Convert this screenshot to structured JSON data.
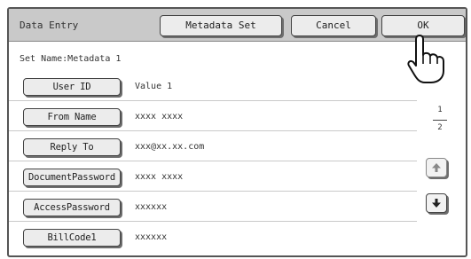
{
  "window": {
    "title": "Data Entry"
  },
  "toolbar": {
    "metadata_set_label": "Metadata Set",
    "cancel_label": "Cancel",
    "ok_label": "OK"
  },
  "set_name": "Set Name:Metadata 1",
  "fields": [
    {
      "label": "User ID",
      "value": "Value 1"
    },
    {
      "label": "From Name",
      "value": "xxxx xxxx"
    },
    {
      "label": "Reply To",
      "value": "xxx@xx.xx.com"
    },
    {
      "label": "DocumentPassword",
      "value": "xxxx xxxx"
    },
    {
      "label": "AccessPassword",
      "value": "xxxxxx"
    },
    {
      "label": "BillCode1",
      "value": "xxxxxx"
    }
  ],
  "pagination": {
    "current": "1",
    "total": "2"
  },
  "icons": {
    "scroll_up": "up-arrow-icon",
    "scroll_down": "down-arrow-icon",
    "pointer": "pointing-hand-icon"
  }
}
